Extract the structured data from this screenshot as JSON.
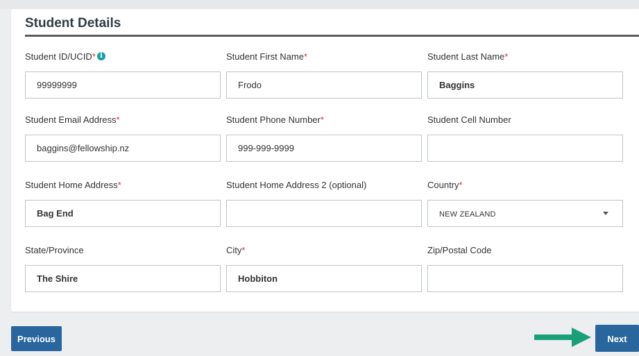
{
  "section": {
    "title": "Student Details"
  },
  "fields": [
    {
      "id": "student-id",
      "label": "Student ID/UCID",
      "required": "*",
      "value": "99999999"
    },
    {
      "id": "first-name",
      "label": "Student First Name",
      "required": "*",
      "value": "Frodo"
    },
    {
      "id": "last-name",
      "label": "Student Last Name",
      "required": "*",
      "value": "Baggins"
    },
    {
      "id": "email",
      "label": "Student Email Address",
      "required": "*",
      "value": "baggins@fellowship.nz"
    },
    {
      "id": "phone",
      "label": "Student Phone Number",
      "required": "*",
      "value": "999-999-9999"
    },
    {
      "id": "cell",
      "label": "Student Cell Number",
      "required": "",
      "value": ""
    },
    {
      "id": "address1",
      "label": "Student Home Address",
      "required": "*",
      "value": "Bag End"
    },
    {
      "id": "address2",
      "label": "Student Home Address 2 (optional)",
      "required": "",
      "value": ""
    },
    {
      "id": "country",
      "label": "Country",
      "required": "*",
      "value": "NEW ZEALAND"
    },
    {
      "id": "state",
      "label": "State/Province",
      "required": "",
      "value": "The Shire"
    },
    {
      "id": "city",
      "label": "City",
      "required": "*",
      "value": "Hobbiton"
    },
    {
      "id": "zip",
      "label": "Zip/Postal Code",
      "required": "",
      "value": ""
    }
  ],
  "info_icon_glyph": "i",
  "buttons": {
    "previous": "Previous",
    "next": "Next"
  },
  "colors": {
    "primary_button": "#2a669e",
    "required_marker": "#d9313b",
    "info_icon": "#18a0a0",
    "annotation_arrow": "#1aa079"
  },
  "annotation": {
    "icon": "arrow-right-icon"
  }
}
